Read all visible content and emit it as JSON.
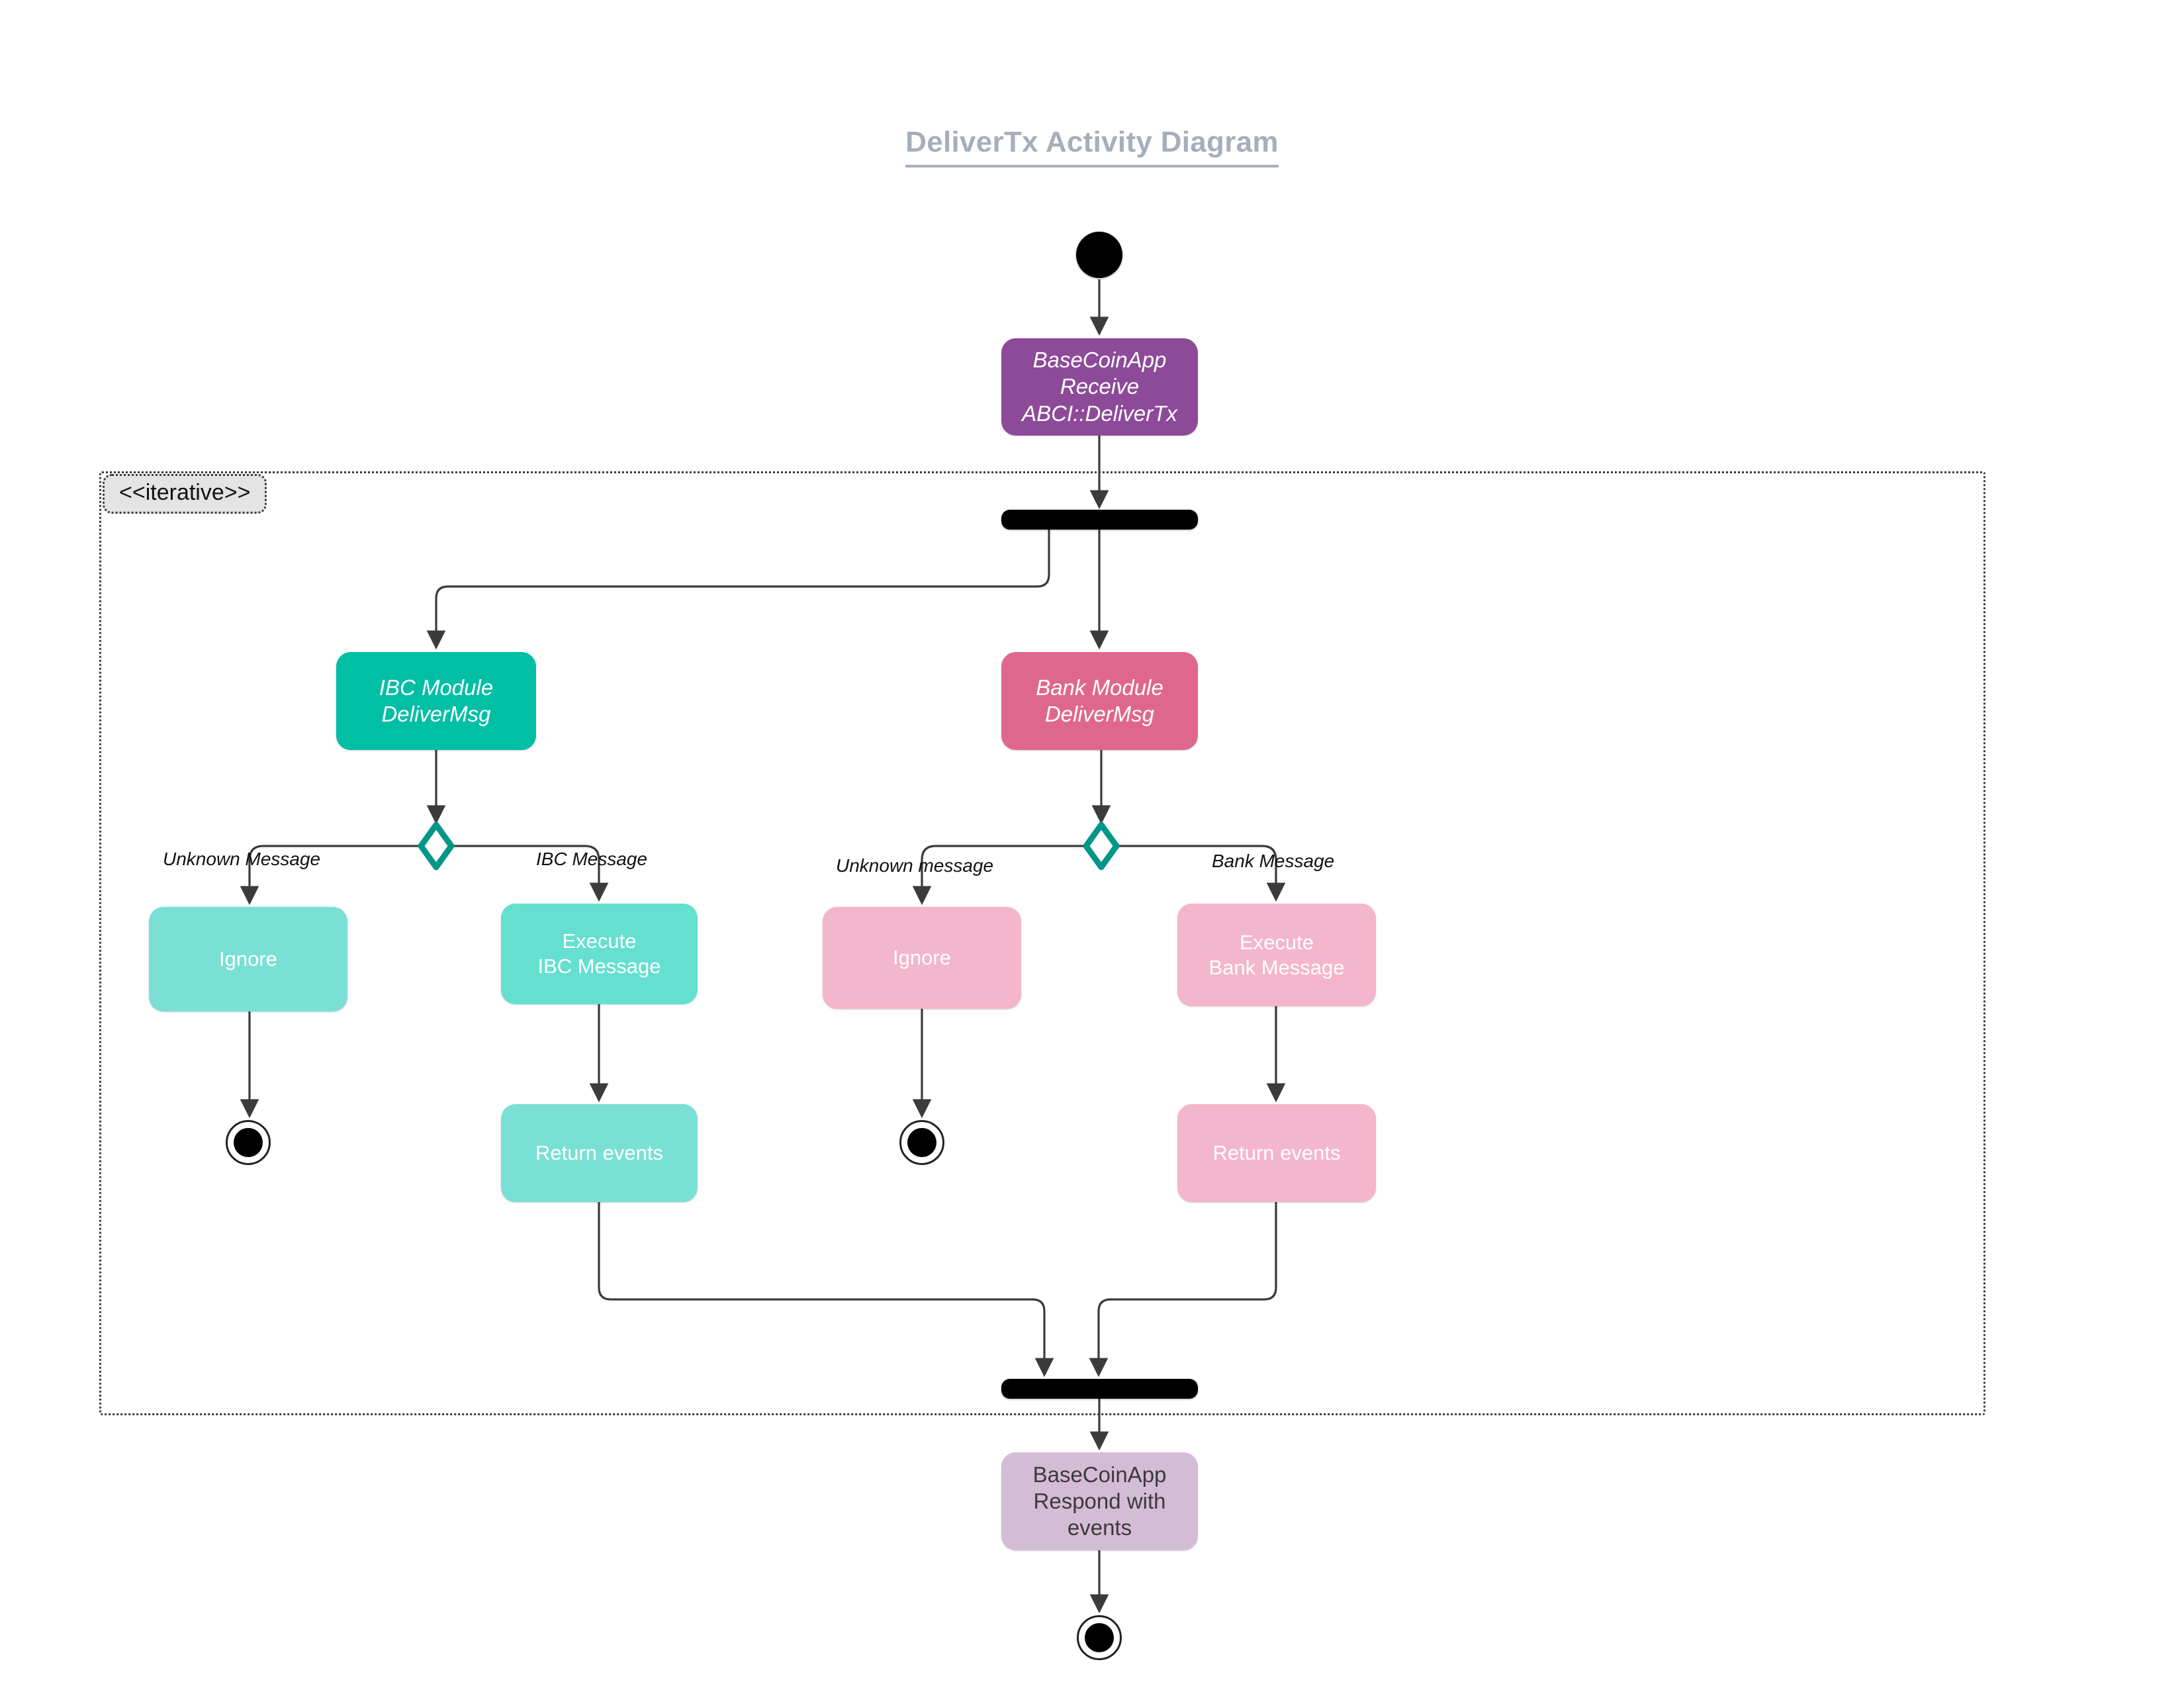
{
  "title": "DeliverTx Activity Diagram",
  "partition": {
    "stereotype": "<<iterative>>"
  },
  "nodes": {
    "start": "",
    "basecoin_receive": "BaseCoinApp\nReceive\nABCI::DeliverTx",
    "ibc_module": "IBC Module\nDeliverMsg",
    "bank_module": "Bank Module\nDeliverMsg",
    "ibc_ignore": "Ignore",
    "ibc_execute": "Execute\nIBC Message",
    "ibc_return": "Return events",
    "bank_ignore": "Ignore",
    "bank_execute": "Execute\nBank Message",
    "bank_return": "Return events",
    "basecoin_respond": "BaseCoinApp\nRespond with\nevents"
  },
  "edge_labels": {
    "ibc_unknown": "Unknown Message",
    "ibc_known": "IBC Message",
    "bank_unknown": "Unknown message",
    "bank_known": "Bank Message"
  },
  "colors": {
    "title": "#a6aebc",
    "basecoin_receive": "#8d4a99",
    "ibc_module": "#00bfa5",
    "bank_module": "#e0678c",
    "ibc_light": "#7ae0d5",
    "bank_light": "#f4b6cc",
    "basecoin_respond": "#d5bcd6",
    "decision_stroke": "#009688",
    "edge": "#333333",
    "bar": "#000000"
  }
}
